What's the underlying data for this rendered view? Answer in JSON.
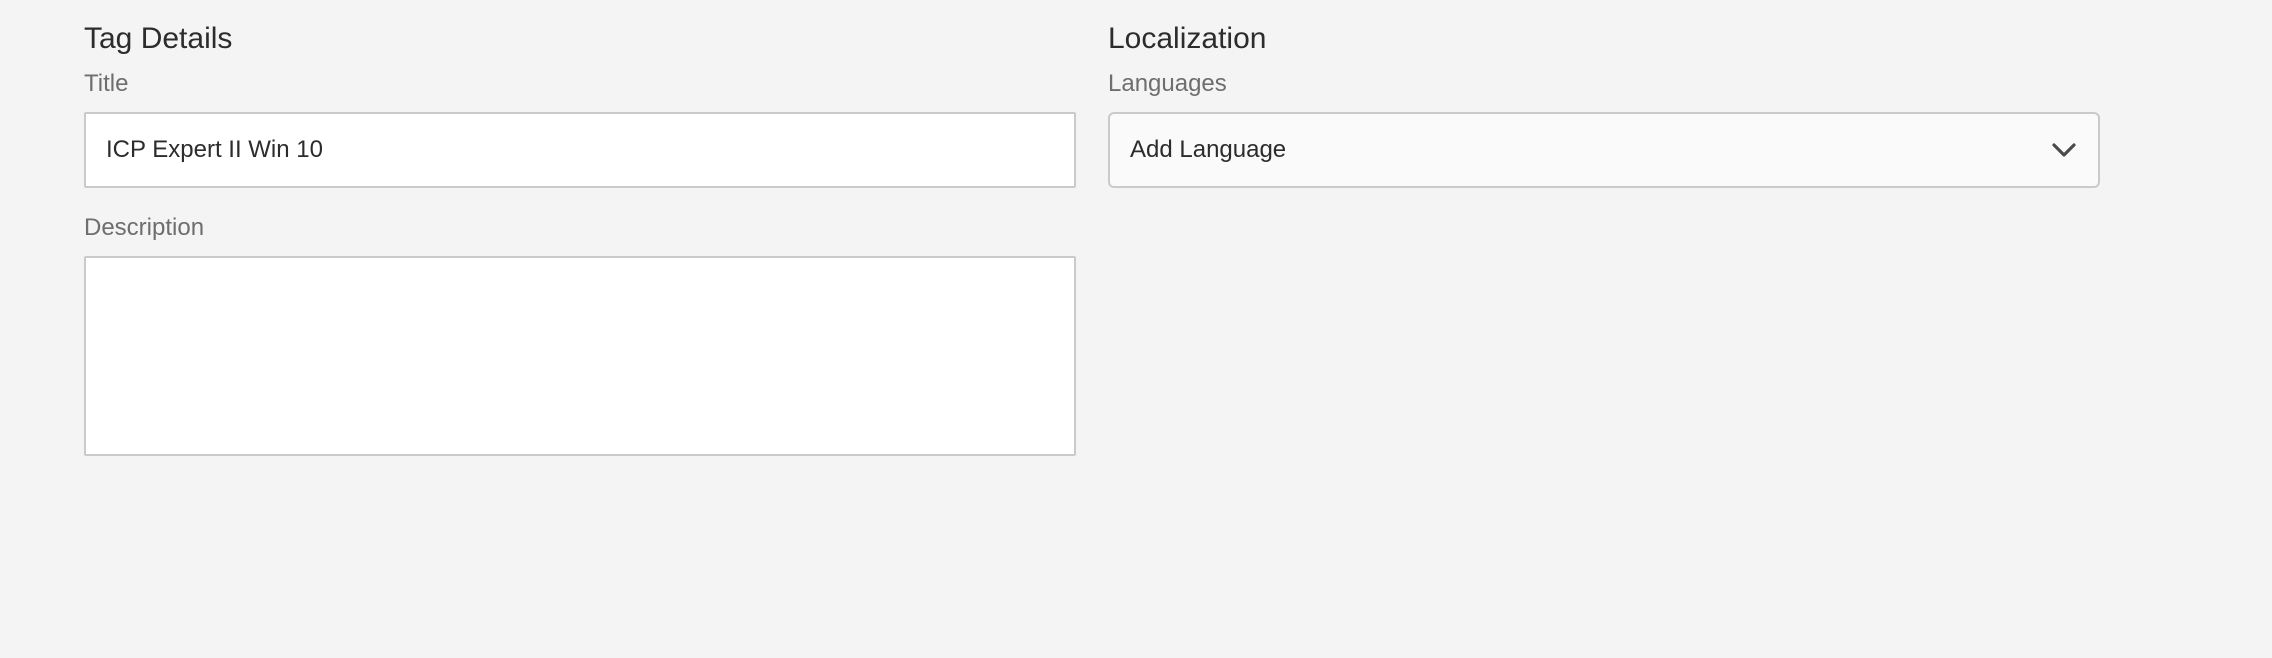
{
  "tag_details": {
    "heading": "Tag Details",
    "title_label": "Title",
    "title_value": "ICP Expert II Win 10",
    "description_label": "Description",
    "description_value": ""
  },
  "localization": {
    "heading": "Localization",
    "languages_label": "Languages",
    "add_language_label": "Add Language",
    "dropdown_icon": "chevron-down-icon"
  }
}
